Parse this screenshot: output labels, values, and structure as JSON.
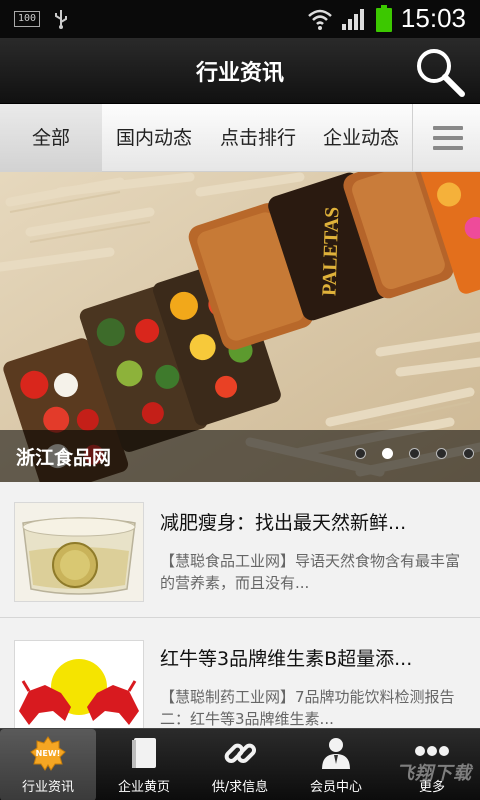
{
  "status_bar": {
    "battery_left_label": "100",
    "time": "15:03"
  },
  "header": {
    "title": "行业资讯"
  },
  "tabs": [
    {
      "label": "全部",
      "active": true
    },
    {
      "label": "国内动态",
      "active": false
    },
    {
      "label": "点击排行",
      "active": false
    },
    {
      "label": "企业动态",
      "active": false
    }
  ],
  "banner": {
    "caption": "浙江食品网",
    "image_text": "PALETAS",
    "slide_count": 5,
    "active_slide_index": 1
  },
  "news": [
    {
      "title": "减肥瘦身：找出最天然新鲜...",
      "summary": "【慧聪食品工业网】导语天然食物含有最丰富的营养素，而且没有...",
      "thumb": "lemon-water-glass"
    },
    {
      "title": "红牛等3品牌维生素B超量添...",
      "summary": "【慧聪制药工业网】7品牌功能饮料检测报告二：红牛等3品牌维生素...",
      "thumb": "red-bull-logo"
    }
  ],
  "bottom_nav": [
    {
      "label": "行业资讯",
      "icon": "new-badge-icon",
      "active": true
    },
    {
      "label": "企业黄页",
      "icon": "book-icon",
      "active": false
    },
    {
      "label": "供/求信息",
      "icon": "link-icon",
      "active": false
    },
    {
      "label": "会员中心",
      "icon": "member-icon",
      "active": false
    },
    {
      "label": "更多",
      "icon": "more-dots-icon",
      "active": false
    }
  ],
  "watermark": "飞翔下载",
  "colors": {
    "header_bg": "#1a1a1a",
    "tab_bg": "#f0f0f0",
    "battery_green": "#3cc800",
    "caption_overlay": "#000000"
  }
}
